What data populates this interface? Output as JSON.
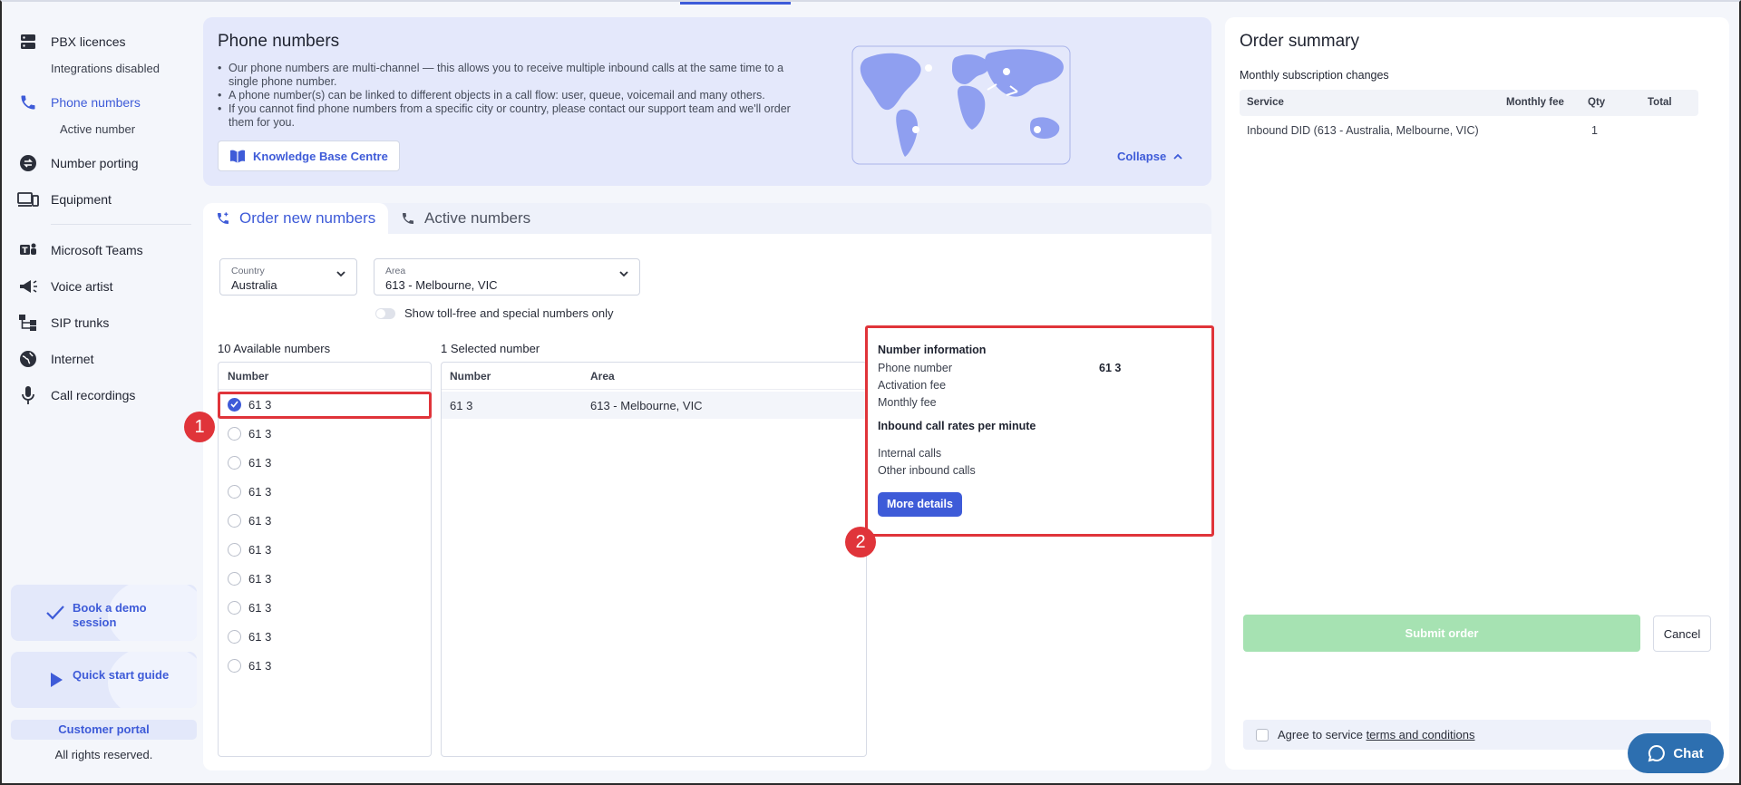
{
  "sidebar": {
    "items": [
      {
        "label": "PBX licences",
        "icon": "server-icon"
      },
      {
        "label": "Phone numbers",
        "icon": "phone-icon"
      },
      {
        "label": "Number porting",
        "icon": "porting-icon"
      },
      {
        "label": "Equipment",
        "icon": "devices-icon"
      },
      {
        "label": "Microsoft Teams",
        "icon": "teams-icon"
      },
      {
        "label": "Voice artist",
        "icon": "megaphone-icon"
      },
      {
        "label": "SIP trunks",
        "icon": "sip-icon"
      },
      {
        "label": "Internet",
        "icon": "globe-icon"
      },
      {
        "label": "Call recordings",
        "icon": "microphone-icon"
      }
    ],
    "sub_integrations": "Integrations disabled",
    "sub_active": "Active number",
    "demo": "Book a demo session",
    "guide": "Quick start guide",
    "portal": "Customer portal",
    "rights": "All rights reserved."
  },
  "banner": {
    "title": "Phone numbers",
    "bullets": [
      "Our phone numbers are multi-channel — this allows you to receive multiple inbound calls at the same time to a single phone number.",
      "A phone number(s) can be linked to different objects in a call flow: user, queue, voicemail and many others.",
      "If you cannot find phone numbers from a specific city or country, please contact our support team and we'll order them for you."
    ],
    "kb_button": "Knowledge Base Centre",
    "collapse": "Collapse"
  },
  "tabs": {
    "order": "Order new numbers",
    "active": "Active numbers"
  },
  "filters": {
    "country_label": "Country",
    "country_value": "Australia",
    "area_label": "Area",
    "area_value": "613 - Melbourne, VIC",
    "toll_free": "Show toll-free and special numbers only"
  },
  "available": {
    "title": "10 Available numbers",
    "header": "Number",
    "rows": [
      "61 3",
      "61 3",
      "61 3",
      "61 3",
      "61 3",
      "61 3",
      "61 3",
      "61 3",
      "61 3",
      "61 3"
    ]
  },
  "selected": {
    "title": "1 Selected number",
    "header_number": "Number",
    "header_area": "Area",
    "row_number": "61 3",
    "row_area": "613 - Melbourne, VIC"
  },
  "info": {
    "title": "Number information",
    "phone_label": "Phone number",
    "phone_value": "61 3",
    "activation_label": "Activation fee",
    "monthly_label": "Monthly fee",
    "rates_title": "Inbound call rates per minute",
    "internal_label": "Internal calls",
    "other_label": "Other inbound calls",
    "more_button": "More details"
  },
  "annotations": {
    "one": "1",
    "two": "2"
  },
  "summary": {
    "title": "Order summary",
    "subtitle": "Monthly subscription changes",
    "col_service": "Service",
    "col_fee": "Monthly fee",
    "col_qty": "Qty",
    "col_total": "Total",
    "row_service": "Inbound DID (613 - Australia, Melbourne, VIC)",
    "row_qty": "1",
    "submit": "Submit order",
    "cancel": "Cancel",
    "agree_prefix": "Agree to service",
    "agree_link": "terms and conditions"
  },
  "chat": {
    "label": "Chat"
  },
  "colors": {
    "accent": "#3e5bd8",
    "highlight": "#e0343a",
    "submit_disabled": "#a6e2b2"
  }
}
